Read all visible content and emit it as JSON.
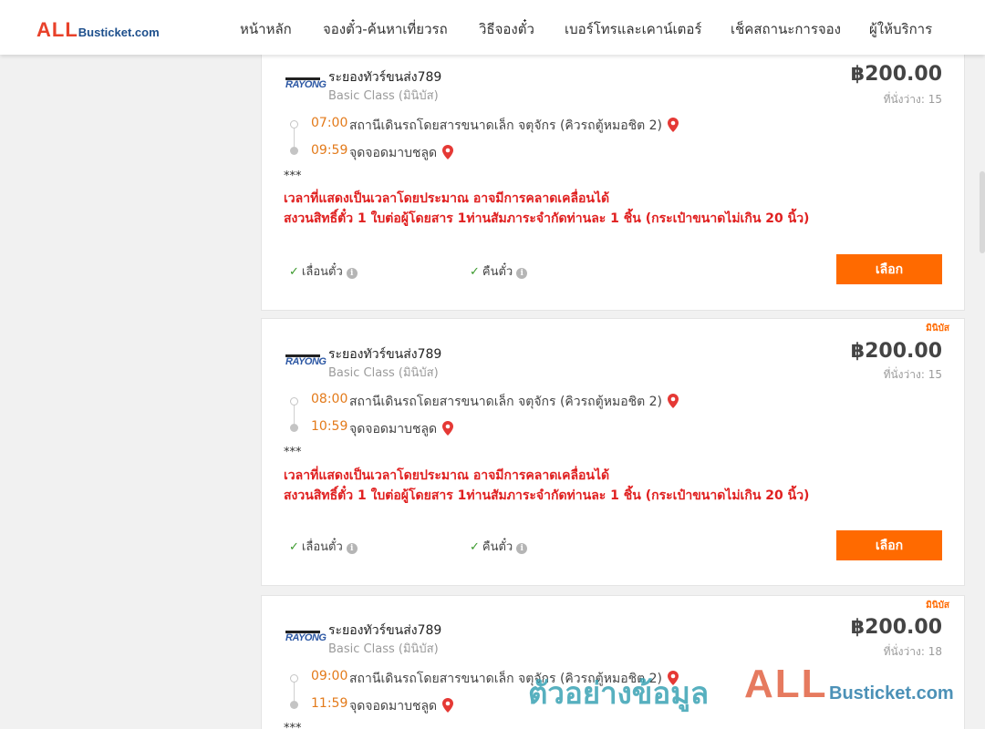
{
  "header": {
    "logo_all": "ALL",
    "logo_rest": "Busticket.com",
    "nav": [
      "หน้าหลัก",
      "จองตั๋ว-ค้นหาเที่ยวรถ",
      "วิธีจองตั๋ว",
      "เบอร์โทรและเคาน์เตอร์",
      "เช็คสถานะการจอง",
      "ผู้ให้บริการ"
    ]
  },
  "colors": {
    "accent": "#ff6a00",
    "notice": "#e02020",
    "time": "#e37a1a",
    "brand_red": "#e8412a"
  },
  "trips": [
    {
      "tag": "",
      "operator_logo": "RAYONG",
      "operator": "ระยองทัวร์ขนส่ง789",
      "bus_class": "Basic Class (มินิบัส)",
      "price": "฿200.00",
      "seats": "ที่นั่งว่าง: 15",
      "depart_time": "07:00",
      "depart_stop": "สถานีเดินรถโดยสารขนาดเล็ก จตุจักร (คิวรถตู้หมอชิต 2)",
      "arrive_time": "09:59",
      "arrive_stop": "จุดจอดมาบชลูด",
      "stars": "***",
      "notice_1": "เวลาที่แสดงเป็นเวลาโดยประมาณ อาจมีการคลาดเคลื่อนได้",
      "notice_2": "สงวนสิทธิ์ตั๋ว 1 ใบต่อผู้โดยสาร 1ท่านสัมภาระจำกัดท่านละ 1 ชิ้น (กระเป๋าขนาดไม่เกิน 20 นิ้ว)",
      "feature_change": "เลื่อนตั๋ว",
      "feature_refund": "คืนตั๋ว",
      "button": "เลือก"
    },
    {
      "tag": "มินิบัส",
      "operator_logo": "RAYONG",
      "operator": "ระยองทัวร์ขนส่ง789",
      "bus_class": "Basic Class (มินิบัส)",
      "price": "฿200.00",
      "seats": "ที่นั่งว่าง: 15",
      "depart_time": "08:00",
      "depart_stop": "สถานีเดินรถโดยสารขนาดเล็ก จตุจักร (คิวรถตู้หมอชิต 2)",
      "arrive_time": "10:59",
      "arrive_stop": "จุดจอดมาบชลูด",
      "stars": "***",
      "notice_1": "เวลาที่แสดงเป็นเวลาโดยประมาณ อาจมีการคลาดเคลื่อนได้",
      "notice_2": "สงวนสิทธิ์ตั๋ว 1 ใบต่อผู้โดยสาร 1ท่านสัมภาระจำกัดท่านละ 1 ชิ้น (กระเป๋าขนาดไม่เกิน 20 นิ้ว)",
      "feature_change": "เลื่อนตั๋ว",
      "feature_refund": "คืนตั๋ว",
      "button": "เลือก"
    },
    {
      "tag": "มินิบัส",
      "operator_logo": "RAYONG",
      "operator": "ระยองทัวร์ขนส่ง789",
      "bus_class": "Basic Class (มินิบัส)",
      "price": "฿200.00",
      "seats": "ที่นั่งว่าง: 18",
      "depart_time": "09:00",
      "depart_stop": "สถานีเดินรถโดยสารขนาดเล็ก จตุจักร (คิวรถตู้หมอชิต 2)",
      "arrive_time": "11:59",
      "arrive_stop": "จุดจอดมาบชลูด",
      "stars": "***"
    }
  ],
  "watermark": {
    "thai": "ตัวอย่างข้อมูล",
    "all": "ALL",
    "rest": "Busticket.com"
  }
}
